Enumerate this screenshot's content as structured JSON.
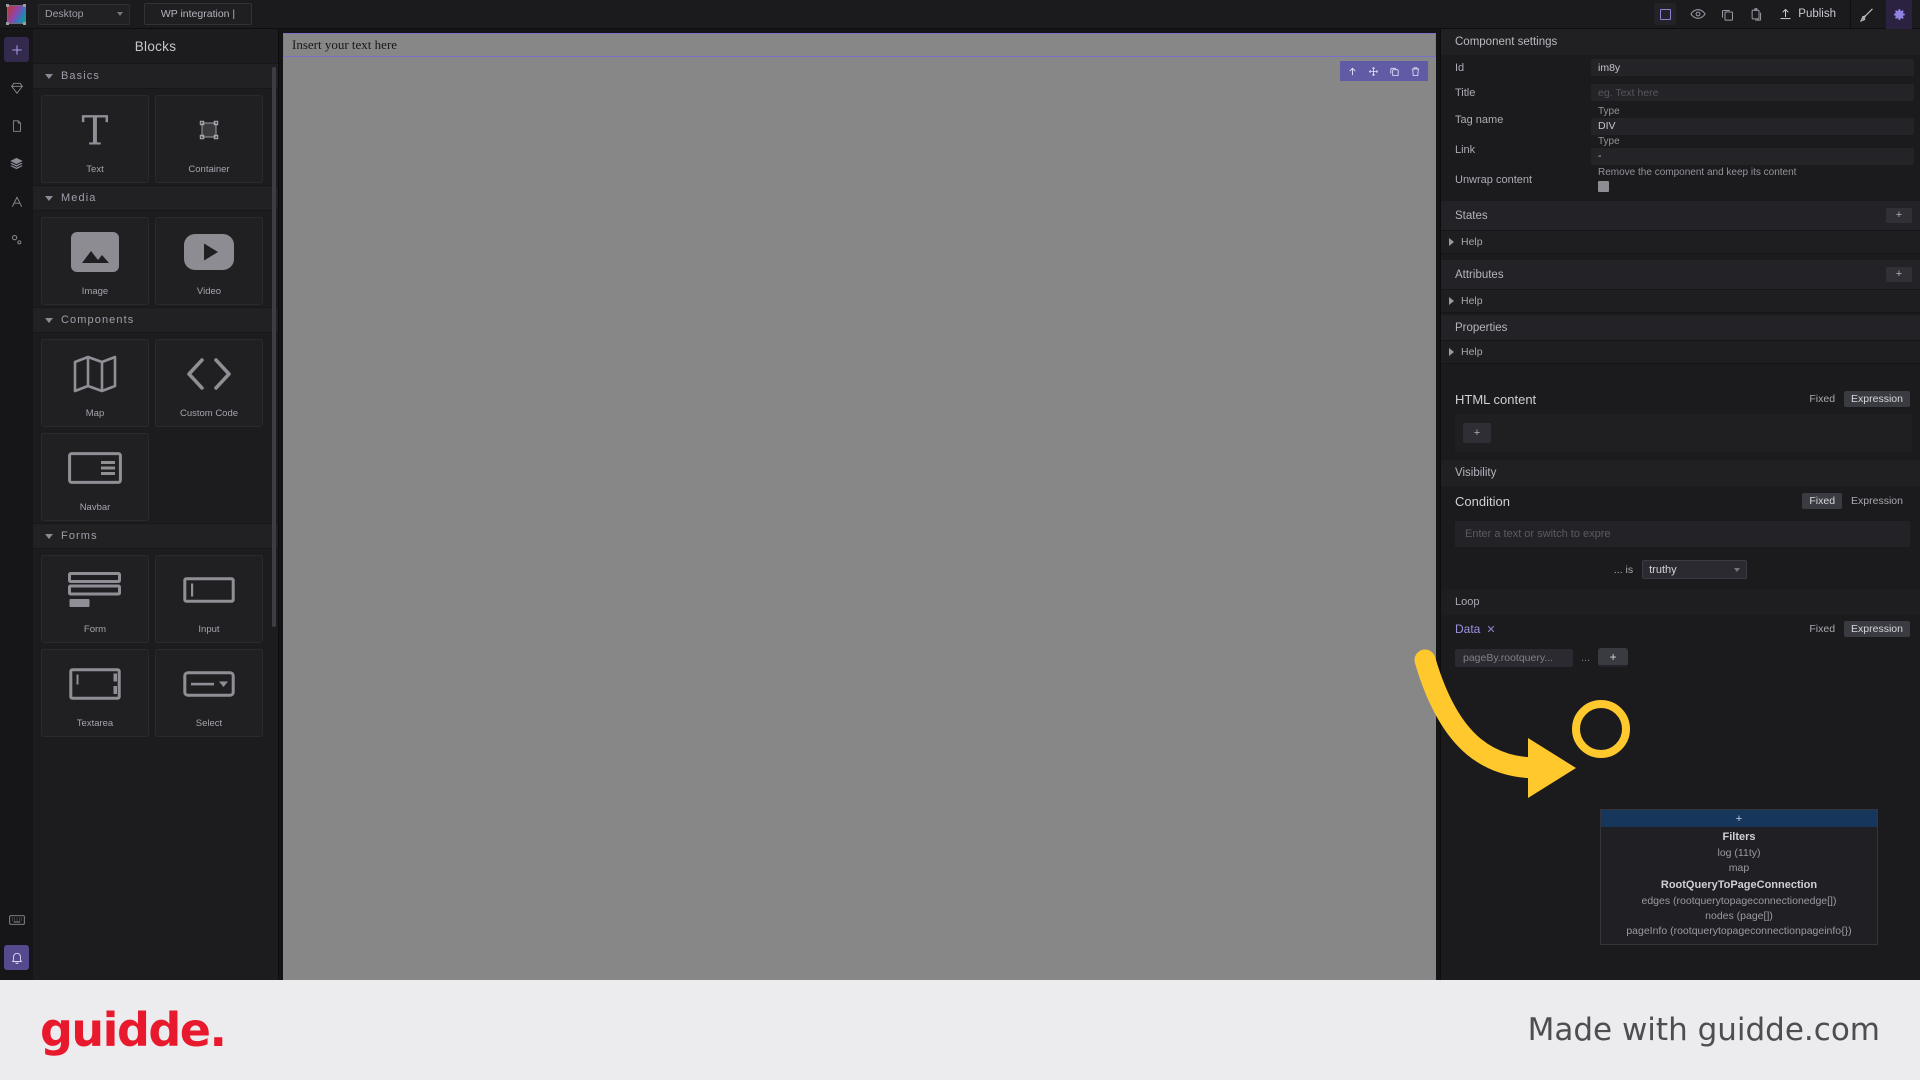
{
  "topbar": {
    "logo_icon": "app-logo-icon",
    "device_select": {
      "value": "Desktop",
      "icon": "chevron-down-icon"
    },
    "project_tab": "WP integration |",
    "icons": [
      {
        "name": "artboard-icon",
        "glyph": "square"
      },
      {
        "name": "preview-eye-icon",
        "glyph": "eye"
      },
      {
        "name": "copy-icon",
        "glyph": "copy"
      },
      {
        "name": "paste-icon",
        "glyph": "paste"
      }
    ],
    "publish_label": "Publish",
    "publish_icon": "upload-icon",
    "brush_icon": "brush-icon",
    "gear_icon": "gear-icon"
  },
  "rail": {
    "items": [
      {
        "name": "add-block-icon",
        "active": true
      },
      {
        "name": "diamond-icon",
        "active": false
      },
      {
        "name": "page-icon",
        "active": false
      },
      {
        "name": "layers-icon",
        "active": false
      },
      {
        "name": "typography-icon",
        "active": false
      },
      {
        "name": "settings-gears-icon",
        "active": false
      }
    ],
    "bottom": [
      {
        "name": "keyboard-icon",
        "active": false
      },
      {
        "name": "bell-icon",
        "active": true
      }
    ]
  },
  "blocks": {
    "title": "Blocks",
    "groups": [
      {
        "label": "Basics",
        "items": [
          {
            "label": "Text",
            "icon": "text-t-icon"
          },
          {
            "label": "Container",
            "icon": "container-box-icon"
          }
        ]
      },
      {
        "label": "Media",
        "items": [
          {
            "label": "Image",
            "icon": "image-icon"
          },
          {
            "label": "Video",
            "icon": "video-play-icon"
          }
        ]
      },
      {
        "label": "Components",
        "items": [
          {
            "label": "Map",
            "icon": "map-icon"
          },
          {
            "label": "Custom Code",
            "icon": "code-brackets-icon"
          },
          {
            "label": "Navbar",
            "icon": "navbar-icon"
          }
        ]
      },
      {
        "label": "Forms",
        "items": [
          {
            "label": "Form",
            "icon": "form-icon"
          },
          {
            "label": "Input",
            "icon": "input-field-icon"
          },
          {
            "label": "Textarea",
            "icon": "textarea-icon"
          },
          {
            "label": "Select",
            "icon": "select-dropdown-icon"
          }
        ]
      }
    ]
  },
  "canvas": {
    "text_block_value": "Insert your text here",
    "selection_toolbar": [
      {
        "name": "select-parent-icon",
        "glyph": "↑"
      },
      {
        "name": "move-icon",
        "glyph": "✛"
      },
      {
        "name": "duplicate-icon",
        "glyph": "❐"
      },
      {
        "name": "delete-icon",
        "glyph": "🗑"
      }
    ]
  },
  "settings": {
    "header": "Component settings",
    "fields": [
      {
        "label": "Id",
        "value": "im8y",
        "placeholder": "",
        "caption": ""
      },
      {
        "label": "Title",
        "value": "",
        "placeholder": "eg. Text here",
        "caption": ""
      },
      {
        "label": "Tag name",
        "value": "DIV",
        "placeholder": "",
        "caption": "Type"
      },
      {
        "label": "Link",
        "value": "-",
        "placeholder": "",
        "caption": "Type"
      },
      {
        "label": "Unwrap content",
        "value": "",
        "placeholder": "",
        "caption": "Remove the component and keep its content"
      }
    ],
    "sections": [
      {
        "title": "States",
        "add_label": "+",
        "help_label": "Help"
      },
      {
        "title": "Attributes",
        "add_label": "+",
        "help_label": "Help"
      },
      {
        "title": "Properties",
        "add_label": "",
        "help_label": "Help"
      }
    ],
    "html_content": {
      "title": "HTML content",
      "mode_fixed": "Fixed",
      "mode_expression": "Expression",
      "active_mode": "Expression",
      "add_label": "+"
    },
    "visibility": {
      "title": "Visibility",
      "condition_title": "Condition",
      "mode_fixed": "Fixed",
      "mode_expression": "Expression",
      "active_mode": "Fixed",
      "input_placeholder": "Enter a text or switch to expre",
      "is_label": "... is",
      "operator_value": "truthy"
    },
    "loop": {
      "title": "Loop",
      "data_label": "Data",
      "remove_glyph": "✕",
      "mode_fixed": "Fixed",
      "mode_expression": "Expression",
      "active_mode": "Expression",
      "token_text": "pageBy.rootquery...",
      "ellipsis": "...",
      "add_label": "+"
    }
  },
  "dropdown": {
    "add_label": "+",
    "groups": [
      {
        "title": "Filters",
        "items": [
          "log (11ty)",
          "map"
        ]
      },
      {
        "title": "RootQueryToPageConnection",
        "items": [
          "edges (rootquerytopageconnectionedge[])",
          "nodes (page[])",
          "pageInfo (rootquerytopageconnectionpageinfo{})"
        ]
      }
    ]
  },
  "footer": {
    "logo_text": "guidde.",
    "tagline": "Made with guidde.com",
    "accent_color": "#E8192C"
  },
  "annotation": {
    "arrow_color": "#FFC82C",
    "highlight_target": "loop-data-add-button"
  }
}
